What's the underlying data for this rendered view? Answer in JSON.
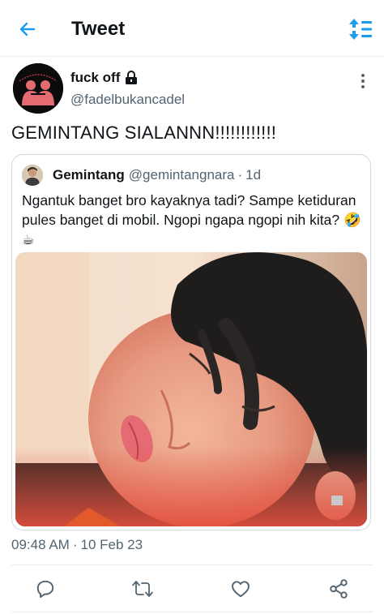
{
  "header": {
    "title": "Tweet",
    "back_icon": "arrow-left-icon",
    "sort_icon": "sort-arrows-icon",
    "accent": "#1d9bf0"
  },
  "tweet": {
    "display_name": "fuck off",
    "lock_icon": "lock-icon",
    "handle": "@fadelbukancadel",
    "text": "GEMINTANG SIALANNN!!!!!!!!!!!!",
    "time": "09:48 AM",
    "separator": "·",
    "date": "10 Feb 23"
  },
  "quoted": {
    "name": "Gemintang",
    "handle": "@gemintangnara",
    "separator": "·",
    "age": "1d",
    "text": "Ngantuk banget bro kayaknya tadi? Sampe ketiduran pules banget di mobil. Ngopi ngapa ngopi nih kita? 🤣 ☕"
  },
  "actions": [
    "reply-icon",
    "retweet-icon",
    "like-icon",
    "share-icon"
  ]
}
